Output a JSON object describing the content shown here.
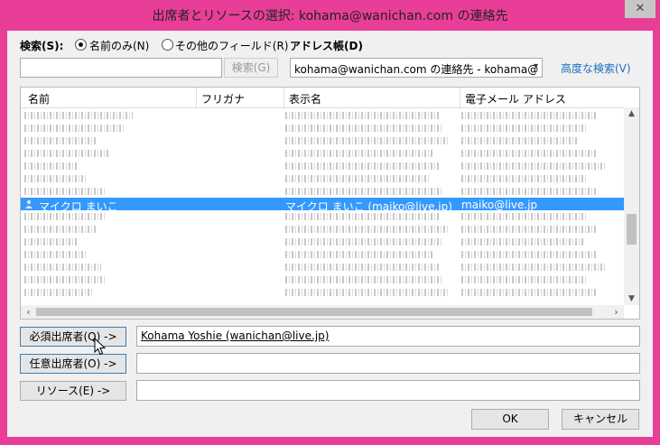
{
  "window": {
    "title": "出席者とリソースの選択: kohama@wanichan.com の連絡先",
    "close_glyph": "✕"
  },
  "search": {
    "label": "検索(S):",
    "option_name_only": "名前のみ(N)",
    "option_other_fields": "その他のフィールド(R)",
    "selected_option": "name_only",
    "query": "",
    "search_button": "検索(G)"
  },
  "address_book": {
    "label": "アドレス帳(D)",
    "selected": "kohama@wanichan.com の連絡先 - kohama@",
    "advanced_link": "高度な検索(V)"
  },
  "list": {
    "columns": [
      "名前",
      "フリガナ",
      "表示名",
      "電子メール アドレス"
    ],
    "sort_glyph": "⌃",
    "selected_row": {
      "name": "マイクロ まいこ",
      "furigana": "",
      "display_name": "マイクロ まいこ (maiko@live.jp)",
      "email": "maiko@live.jp"
    }
  },
  "attendees": {
    "required_button": "必須出席者(Q) ->",
    "required_value": "Kohama Yoshie (wanichan@live.jp)",
    "optional_button": "任意出席者(O) ->",
    "optional_value": "",
    "resources_button": "リソース(E) ->",
    "resources_value": ""
  },
  "footer": {
    "ok": "OK",
    "cancel": "キャンセル"
  },
  "colors": {
    "frame": "#e83e98",
    "selection": "#3399ff",
    "link": "#1a6fc2"
  }
}
